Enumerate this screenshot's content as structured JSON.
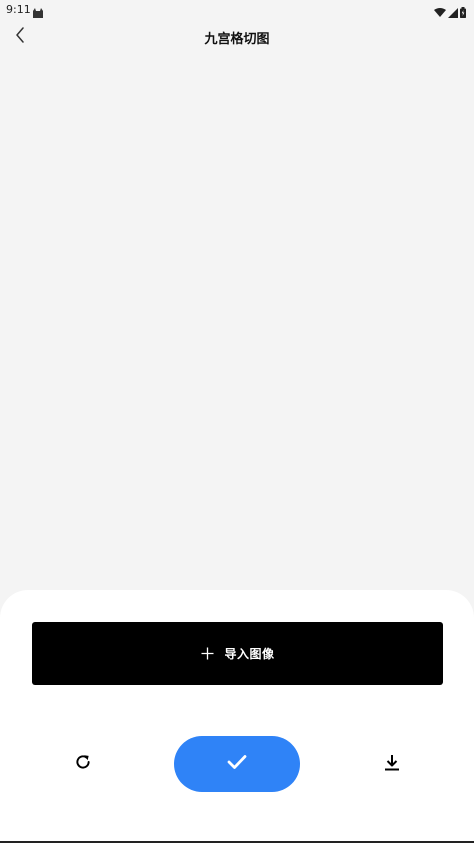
{
  "status_bar": {
    "time": "9:11",
    "icons": [
      "notification-cat-icon",
      "wifi-icon",
      "signal-icon",
      "battery-icon"
    ]
  },
  "header": {
    "title": "九宫格切图",
    "back_icon": "chevron-left-icon"
  },
  "bottom_sheet": {
    "import_button": {
      "icon": "plus-icon",
      "label": "导入图像"
    },
    "actions": {
      "reset_icon": "refresh-icon",
      "confirm_icon": "check-icon",
      "download_icon": "download-icon"
    }
  },
  "colors": {
    "background": "#f4f4f4",
    "sheet": "#ffffff",
    "import_button": "#000000",
    "confirm_button": "#2f83f7"
  }
}
